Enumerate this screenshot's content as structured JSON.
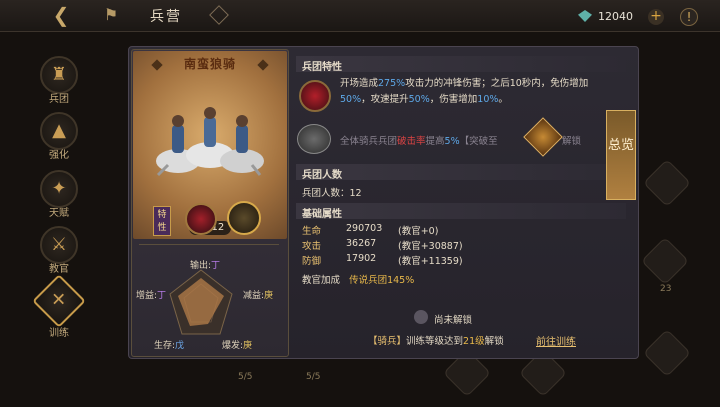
{
  "header": {
    "title": "兵营",
    "currency": "12040"
  },
  "sidebar": [
    {
      "label": "兵团",
      "icon": "helmet-icon"
    },
    {
      "label": "强化",
      "icon": "upgrade-icon"
    },
    {
      "label": "天赋",
      "icon": "talent-icon"
    },
    {
      "label": "教官",
      "icon": "instructor-icon"
    },
    {
      "label": "训练",
      "icon": "crossed-swords-icon"
    }
  ],
  "unit": {
    "name": "南蛮狼骑",
    "count": "12",
    "trait_tag": "特性",
    "radar": {
      "output_label": "输出:",
      "output_grade": "丁",
      "buff_label": "增益:",
      "buff_grade": "丁",
      "debuff_label": "减益:",
      "debuff_grade": "庚",
      "survive_label": "生存:",
      "survive_grade": "戊",
      "burst_label": "爆发:",
      "burst_grade": "庚"
    }
  },
  "traits": {
    "section_title": "兵团特性",
    "trait1_a": "开场造成",
    "trait1_pct1": "275%",
    "trait1_b": "攻击力的冲锋伤害；之后10秒内，免伤增加",
    "trait1_pct2": "50%",
    "trait1_c": "，攻速提升",
    "trait1_pct3": "50%",
    "trait1_d": "，伤害增加",
    "trait1_pct4": "10%",
    "trait1_e": "。",
    "trait2_a": "全体骑兵兵团",
    "trait2_red": "破击率",
    "trait2_b": "提高",
    "trait2_pct": "5%",
    "trait2_c": "【突破至",
    "trait2_unlock": "解锁"
  },
  "troops": {
    "section_title": "兵团人数",
    "label": "兵团人数：",
    "value": "12"
  },
  "stats": {
    "section_title": "基础属性",
    "rows": [
      {
        "label": "生命",
        "value": "290703",
        "bonus": "(教官+0)"
      },
      {
        "label": "攻击",
        "value": "36267",
        "bonus": "(教官+30887)"
      },
      {
        "label": "防御",
        "value": "17902",
        "bonus": "(教官+11359)"
      }
    ],
    "instructor_label": "教官加成",
    "instructor_value": "传说兵团145%"
  },
  "lock": {
    "text": "尚未解锁",
    "req_a": "【骑兵】",
    "req_b": "训练等级达到",
    "req_level": "21级",
    "req_c": "解锁",
    "goto": "前往训练"
  },
  "overview_label": "总览",
  "background": {
    "badges": [
      "5/5",
      "5/5"
    ],
    "number": "23"
  }
}
